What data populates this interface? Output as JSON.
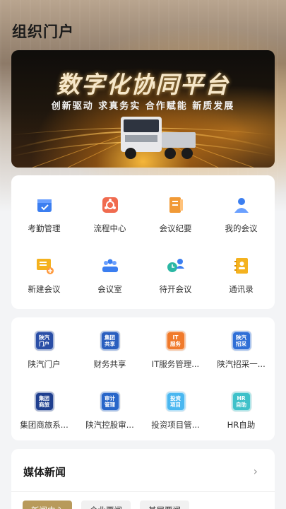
{
  "header": {
    "title": "组织门户"
  },
  "banner": {
    "title": "数字化协同平台",
    "subtitle": "创新驱动  求真务实  合作赋能  新质发展"
  },
  "office": {
    "items": [
      {
        "label": "考勤管理",
        "icon": "calendar-check-icon",
        "color": "#3b7ef0"
      },
      {
        "label": "流程中心",
        "icon": "flow-icon",
        "color": "#f06b4f"
      },
      {
        "label": "会议纪要",
        "icon": "notes-icon",
        "color": "#f19a36"
      },
      {
        "label": "我的会议",
        "icon": "person-icon",
        "color": "#3b7ef0"
      },
      {
        "label": "新建会议",
        "icon": "board-add-icon",
        "color": "#f4b21f"
      },
      {
        "label": "会议室",
        "icon": "meeting-room-icon",
        "color": "#3b7ef0"
      },
      {
        "label": "待开会议",
        "icon": "pending-meeting-icon",
        "color": "#2bb7a4"
      },
      {
        "label": "通讯录",
        "icon": "contacts-book-icon",
        "color": "#f4b21f"
      }
    ]
  },
  "apps": {
    "items": [
      {
        "label": "陕汽门户",
        "badge": "陕汽\n门户",
        "color": "#2a4ea6"
      },
      {
        "label": "财务共享",
        "badge": "集团\n共享",
        "color": "#2a5fbf"
      },
      {
        "label": "IT服务管理...",
        "badge": "IT\n服务",
        "color": "#f07a2b"
      },
      {
        "label": "陕汽招采一...",
        "badge": "陕汽\n招采",
        "color": "#2f6fd6"
      },
      {
        "label": "集团商旅系...",
        "badge": "集团\n商旅",
        "color": "#1f3f8f"
      },
      {
        "label": "陕汽控股审...",
        "badge": "审计\n管理",
        "color": "#2866c9"
      },
      {
        "label": "投资项目管...",
        "badge": "投资\n项目",
        "color": "#4ab7f0"
      },
      {
        "label": "HR自助",
        "badge": "HR\n自助",
        "color": "#3fc1c9"
      }
    ]
  },
  "news": {
    "title": "媒体新闻",
    "more": "›",
    "tabs": [
      "新闻中心",
      "企业要闻",
      "基层要闻"
    ]
  }
}
